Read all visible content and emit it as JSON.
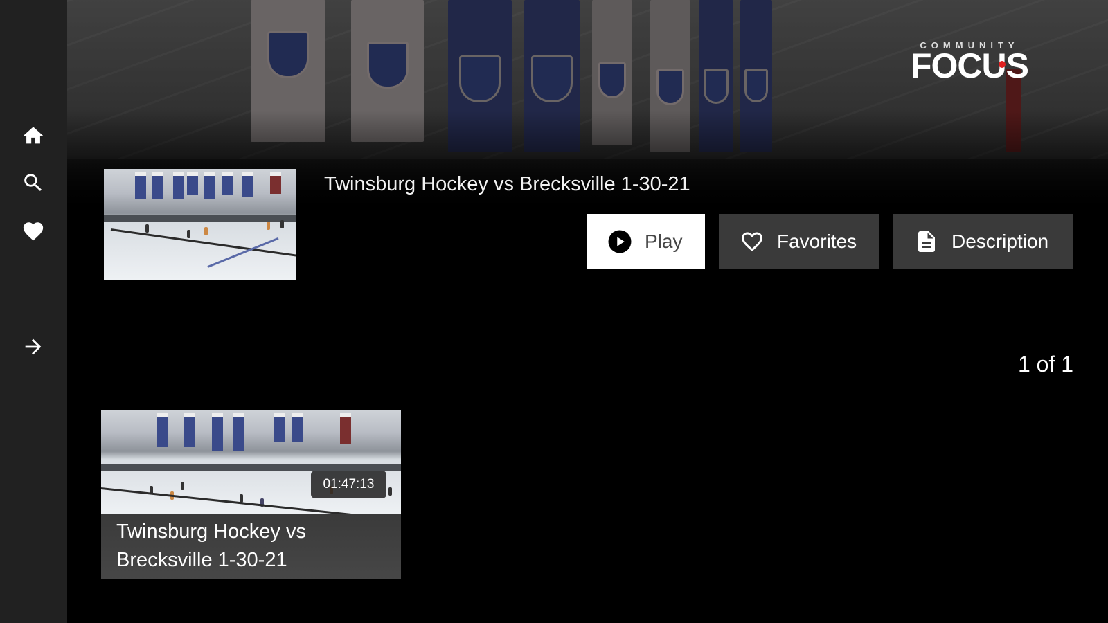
{
  "brand": {
    "top": "COMMUNITY",
    "main": "FOCUS"
  },
  "sidebar": {
    "items": [
      {
        "name": "home",
        "icon": "home-icon"
      },
      {
        "name": "search",
        "icon": "search-icon"
      },
      {
        "name": "favorites",
        "icon": "heart-icon"
      },
      {
        "name": "expand",
        "icon": "arrow-right-icon"
      }
    ]
  },
  "featured": {
    "title": "Twinsburg Hockey vs Brecksville 1-30-21",
    "buttons": {
      "play": "Play",
      "favorites": "Favorites",
      "description": "Description"
    }
  },
  "pager": "1 of 1",
  "cards": [
    {
      "title": "Twinsburg Hockey vs Brecksville 1-30-21",
      "duration": "01:47:13"
    }
  ],
  "colors": {
    "sidebar": "#212121",
    "button_dark": "#3a3a3a",
    "button_light": "#ffffff",
    "accent": "#e02020"
  }
}
